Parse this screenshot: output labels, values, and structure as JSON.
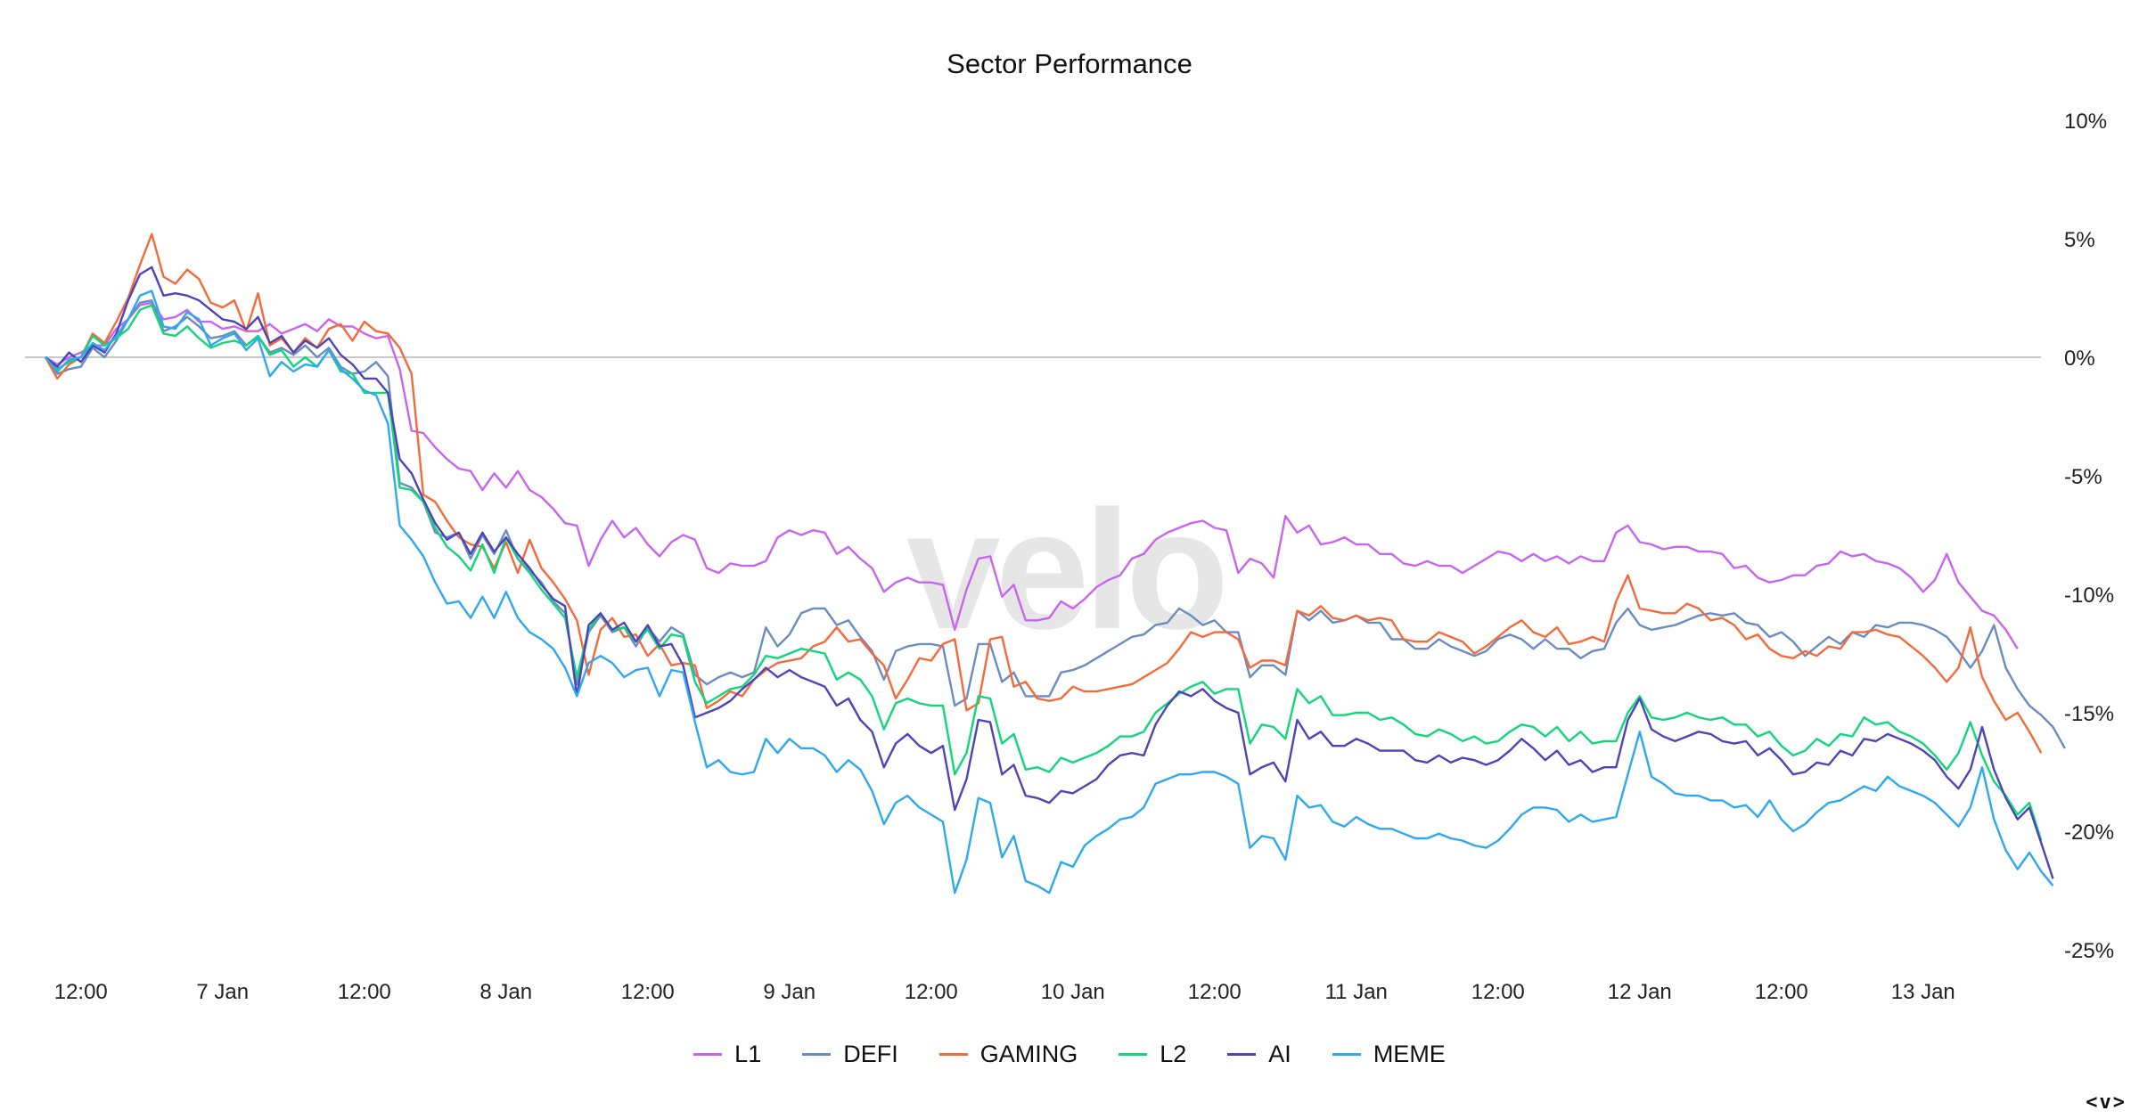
{
  "chart_data": {
    "type": "line",
    "title": "Sector Performance",
    "xlabel": "",
    "ylabel": "",
    "y_axis_position": "right",
    "ylim": [
      -25,
      10
    ],
    "yticks": [
      10,
      5,
      0,
      -5,
      -10,
      -15,
      -20,
      -25
    ],
    "ytick_labels": [
      "10%",
      "5%",
      "0%",
      "-5%",
      "-10%",
      "-15%",
      "-20%",
      "-25%"
    ],
    "x_start": "6 Jan 09:00",
    "x_step": "1 hour",
    "x_count": 168,
    "xticks": [
      {
        "hour": 3,
        "label": "12:00"
      },
      {
        "hour": 15,
        "label": "7 Jan"
      },
      {
        "hour": 27,
        "label": "12:00"
      },
      {
        "hour": 39,
        "label": "8 Jan"
      },
      {
        "hour": 51,
        "label": "12:00"
      },
      {
        "hour": 63,
        "label": "9 Jan"
      },
      {
        "hour": 75,
        "label": "12:00"
      },
      {
        "hour": 87,
        "label": "10 Jan"
      },
      {
        "hour": 99,
        "label": "12:00"
      },
      {
        "hour": 111,
        "label": "11 Jan"
      },
      {
        "hour": 123,
        "label": "12:00"
      },
      {
        "hour": 135,
        "label": "12 Jan"
      },
      {
        "hour": 147,
        "label": "12:00"
      },
      {
        "hour": 159,
        "label": "13 Jan"
      }
    ],
    "zero_line": true,
    "grid": false,
    "legend_position": "bottom",
    "watermark": "velo",
    "series": [
      {
        "name": "L1",
        "color": "#c865f0",
        "values": [
          0,
          -0.3,
          0,
          0.2,
          0.5,
          0.5,
          1.2,
          1.6,
          2.2,
          2.3,
          1.6,
          1.7,
          2,
          1.5,
          1.5,
          1.2,
          1.3,
          1.1,
          1.1,
          1.4,
          1,
          1.2,
          1.4,
          1.1,
          1.6,
          1.3,
          1.3,
          1.0,
          0.8,
          0.9,
          -0.5,
          -3.1,
          -3.2,
          -3.8,
          -4.3,
          -4.7,
          -4.8,
          -5.6,
          -4.9,
          -5.5,
          -4.8,
          -5.6,
          -5.9,
          -6.4,
          -7.0,
          -7.1,
          -8.8,
          -7.7,
          -6.9,
          -7.6,
          -7.2,
          -7.9,
          -8.4,
          -7.8,
          -7.5,
          -7.7,
          -8.9,
          -9.1,
          -8.7,
          -8.8,
          -8.8,
          -8.6,
          -7.6,
          -7.3,
          -7.5,
          -7.3,
          -7.4,
          -8.3,
          -8.0,
          -8.5,
          -8.9,
          -9.9,
          -9.5,
          -9.3,
          -9.5,
          -9.5,
          -9.6,
          -11.5,
          -9.8,
          -8.5,
          -8.4,
          -10.1,
          -9.6,
          -11.1,
          -11.1,
          -11.0,
          -10.3,
          -10.6,
          -10.2,
          -9.7,
          -9.4,
          -9.2,
          -8.5,
          -8.3,
          -7.7,
          -7.4,
          -7.2,
          -7.0,
          -6.9,
          -7.2,
          -7.3,
          -9.1,
          -8.5,
          -8.7,
          -9.3,
          -6.7,
          -7.4,
          -7.1,
          -7.9,
          -7.8,
          -7.6,
          -7.9,
          -7.9,
          -8.3,
          -8.3,
          -8.7,
          -8.8,
          -8.6,
          -8.8,
          -8.8,
          -9.1,
          -8.8,
          -8.5,
          -8.2,
          -8.3,
          -8.6,
          -8.3,
          -8.6,
          -8.4,
          -8.7,
          -8.4,
          -8.6,
          -8.6,
          -7.4,
          -7.1,
          -7.8,
          -7.9,
          -8.1,
          -8.0,
          -8.0,
          -8.2,
          -8.2,
          -8.3,
          -8.9,
          -8.8,
          -9.3,
          -9.5,
          -9.4,
          -9.2,
          -9.2,
          -8.8,
          -8.7,
          -8.2,
          -8.4,
          -8.3,
          -8.6,
          -8.7,
          -8.9,
          -9.3,
          -9.9,
          -9.4,
          -8.3,
          -9.5,
          -10.1,
          -10.7,
          -10.9,
          -11.5,
          -12.3
        ]
      },
      {
        "name": "DEFI",
        "color": "#6b8cc0",
        "values": [
          0,
          -0.7,
          -0.5,
          -0.4,
          0.4,
          0,
          0.7,
          1.6,
          2.3,
          2.4,
          1.1,
          1.3,
          1.7,
          1.3,
          0.8,
          0.9,
          1.1,
          0.5,
          0.9,
          0.2,
          0.4,
          0.1,
          0.5,
          0,
          0.4,
          -0.4,
          -0.7,
          -0.6,
          -0.2,
          -0.8,
          -5.3,
          -5.5,
          -6.1,
          -7.4,
          -7.6,
          -7.4,
          -8.5,
          -7.5,
          -8.3,
          -7.3,
          -8.5,
          -9.0,
          -9.5,
          -10.3,
          -10.8,
          -13.8,
          -11.6,
          -10.9,
          -11.6,
          -11.4,
          -12.2,
          -11.4,
          -12.0,
          -11.4,
          -11.7,
          -13.4,
          -13.8,
          -13.5,
          -13.3,
          -13.5,
          -13.3,
          -11.4,
          -12.2,
          -11.7,
          -10.8,
          -10.6,
          -10.6,
          -11.3,
          -11.1,
          -11.8,
          -12.4,
          -13.6,
          -12.4,
          -12.2,
          -12.1,
          -12.1,
          -12.2,
          -14.7,
          -14.4,
          -12.1,
          -12.1,
          -13.7,
          -13.3,
          -14.3,
          -14.3,
          -14.3,
          -13.3,
          -13.2,
          -13.0,
          -12.7,
          -12.4,
          -12.1,
          -11.8,
          -11.7,
          -11.3,
          -11.2,
          -10.6,
          -10.9,
          -11.3,
          -11.1,
          -11.6,
          -11.6,
          -13.5,
          -13.0,
          -13.0,
          -13.4,
          -10.7,
          -11.1,
          -10.7,
          -11.2,
          -11.1,
          -10.9,
          -11.2,
          -11.2,
          -11.9,
          -11.9,
          -12.3,
          -12.3,
          -11.9,
          -12.2,
          -12.4,
          -12.6,
          -12.4,
          -11.9,
          -11.7,
          -11.9,
          -12.3,
          -11.9,
          -12.3,
          -12.3,
          -12.7,
          -12.4,
          -12.3,
          -11.2,
          -10.6,
          -11.3,
          -11.5,
          -11.4,
          -11.3,
          -11.1,
          -10.9,
          -10.8,
          -10.9,
          -10.8,
          -11.2,
          -11.3,
          -11.8,
          -11.6,
          -12.0,
          -12.6,
          -12.2,
          -11.8,
          -12.1,
          -11.6,
          -11.8,
          -11.3,
          -11.4,
          -11.2,
          -11.2,
          -11.3,
          -11.5,
          -11.8,
          -12.4,
          -13.1,
          -12.4,
          -11.3,
          -13.1,
          -14.0,
          -14.7,
          -15.1,
          -15.6,
          -16.5
        ]
      },
      {
        "name": "GAMING",
        "color": "#f56a3a",
        "values": [
          0,
          -0.9,
          -0.3,
          0,
          1,
          0.6,
          1.5,
          2.5,
          3.9,
          5.2,
          3.4,
          3.1,
          3.7,
          3.3,
          2.3,
          2.1,
          2.4,
          1.1,
          2.7,
          0.5,
          0.8,
          0.2,
          0.8,
          0.4,
          1.2,
          1.4,
          0.7,
          1.5,
          1.1,
          1.0,
          0.4,
          -0.7,
          -5.8,
          -6.1,
          -6.9,
          -7.6,
          -7.9,
          -8.0,
          -8.9,
          -7.8,
          -9.1,
          -7.7,
          -8.9,
          -9.5,
          -10.2,
          -11.1,
          -13.4,
          -11.5,
          -11.0,
          -11.8,
          -11.7,
          -12.6,
          -12.1,
          -13.0,
          -12.9,
          -13.0,
          -14.8,
          -14.5,
          -14.1,
          -14.3,
          -13.6,
          -13.2,
          -12.9,
          -12.8,
          -12.7,
          -12.2,
          -12.0,
          -11.4,
          -12.0,
          -11.9,
          -12.5,
          -13.0,
          -14.4,
          -13.6,
          -12.7,
          -12.8,
          -12.1,
          -11.9,
          -14.9,
          -14.6,
          -11.9,
          -11.8,
          -13.9,
          -13.7,
          -14.4,
          -14.5,
          -14.4,
          -13.9,
          -14.1,
          -14.1,
          -14.0,
          -13.9,
          -13.8,
          -13.5,
          -13.2,
          -12.9,
          -12.3,
          -11.6,
          -11.8,
          -11.6,
          -11.6,
          -11.9,
          -13.1,
          -12.8,
          -12.8,
          -13.0,
          -10.7,
          -10.9,
          -10.5,
          -11.0,
          -11.1,
          -10.9,
          -11.1,
          -11.0,
          -11.1,
          -11.9,
          -12.0,
          -12.0,
          -11.6,
          -11.8,
          -12.0,
          -12.5,
          -12.2,
          -11.8,
          -11.4,
          -11.1,
          -11.6,
          -11.8,
          -11.4,
          -12.1,
          -12.0,
          -11.8,
          -12.0,
          -10.3,
          -9.2,
          -10.6,
          -10.7,
          -10.8,
          -10.8,
          -10.4,
          -10.6,
          -11.1,
          -11.0,
          -11.3,
          -11.9,
          -11.7,
          -12.3,
          -12.6,
          -12.7,
          -12.4,
          -12.6,
          -12.2,
          -12.3,
          -11.6,
          -11.6,
          -11.5,
          -11.7,
          -11.8,
          -12.2,
          -12.6,
          -13.1,
          -13.7,
          -13.1,
          -11.4,
          -13.5,
          -14.5,
          -15.3,
          -15.0,
          -15.8,
          -16.7
        ]
      },
      {
        "name": "L2",
        "color": "#12d67a",
        "values": [
          0,
          -0.5,
          -0.2,
          0,
          0.9,
          0.5,
          0.8,
          1.2,
          2.0,
          2.2,
          1.0,
          0.9,
          1.3,
          0.8,
          0.4,
          0.6,
          0.7,
          0.5,
          0.9,
          0.1,
          0.3,
          -0.4,
          0,
          -0.4,
          0.3,
          -0.6,
          -0.7,
          -1.5,
          -1.5,
          -1.5,
          -5.5,
          -5.6,
          -6.1,
          -7.2,
          -8.0,
          -8.4,
          -9.0,
          -7.9,
          -9.1,
          -7.6,
          -8.5,
          -9.1,
          -9.8,
          -10.4,
          -11.0,
          -13.5,
          -11.5,
          -10.8,
          -11.5,
          -11.4,
          -12.0,
          -11.5,
          -12.3,
          -11.7,
          -11.8,
          -13.7,
          -14.6,
          -14.3,
          -14.0,
          -13.9,
          -13.4,
          -12.6,
          -12.7,
          -12.5,
          -12.3,
          -12.4,
          -12.5,
          -13.6,
          -13.3,
          -13.6,
          -14.3,
          -15.7,
          -14.6,
          -14.4,
          -14.6,
          -14.7,
          -14.7,
          -17.6,
          -16.7,
          -14.3,
          -14.4,
          -16.3,
          -15.9,
          -17.4,
          -17.3,
          -17.5,
          -16.9,
          -17.1,
          -16.9,
          -16.7,
          -16.4,
          -16.0,
          -16.0,
          -15.8,
          -15.0,
          -14.6,
          -14.2,
          -13.9,
          -13.7,
          -14.2,
          -14.0,
          -14.0,
          -16.3,
          -15.5,
          -15.6,
          -16.1,
          -14.0,
          -14.6,
          -14.3,
          -15.1,
          -15.1,
          -15.0,
          -15.0,
          -15.3,
          -15.2,
          -15.5,
          -15.9,
          -16.0,
          -15.7,
          -15.9,
          -16.2,
          -16.0,
          -16.3,
          -16.2,
          -15.8,
          -15.5,
          -15.6,
          -16.0,
          -15.6,
          -16.2,
          -15.8,
          -16.3,
          -16.2,
          -16.2,
          -15.0,
          -14.3,
          -15.2,
          -15.3,
          -15.2,
          -15.0,
          -15.2,
          -15.3,
          -15.2,
          -15.5,
          -15.5,
          -16.0,
          -15.8,
          -16.4,
          -16.8,
          -16.6,
          -16.1,
          -16.4,
          -15.9,
          -16.0,
          -15.2,
          -15.5,
          -15.4,
          -15.8,
          -16.0,
          -16.3,
          -16.8,
          -17.4,
          -16.7,
          -15.4,
          -16.8,
          -17.9,
          -18.5,
          -19.3,
          -18.8,
          -20.4
        ]
      },
      {
        "name": "AI",
        "color": "#4c44b8",
        "values": [
          0,
          -0.4,
          0.2,
          -0.2,
          0.5,
          0.2,
          1.0,
          2.4,
          3.5,
          3.8,
          2.6,
          2.7,
          2.6,
          2.4,
          2.0,
          1.6,
          1.5,
          1.2,
          1.7,
          0.6,
          0.9,
          0.2,
          0.7,
          0.4,
          0.8,
          0.1,
          -0.3,
          -0.9,
          -0.9,
          -1.5,
          -4.3,
          -4.9,
          -6.0,
          -7.0,
          -7.7,
          -7.4,
          -8.3,
          -7.4,
          -8.2,
          -7.6,
          -8.3,
          -8.9,
          -9.6,
          -10.2,
          -10.5,
          -14.3,
          -11.3,
          -10.8,
          -11.5,
          -11.2,
          -12.0,
          -11.3,
          -12.2,
          -12.1,
          -13.0,
          -15.2,
          -15.0,
          -14.8,
          -14.5,
          -14.0,
          -13.6,
          -13.1,
          -13.5,
          -13.2,
          -13.5,
          -13.7,
          -13.9,
          -14.7,
          -14.4,
          -15.3,
          -15.8,
          -17.3,
          -16.3,
          -15.9,
          -16.4,
          -16.7,
          -16.4,
          -19.1,
          -17.8,
          -15.3,
          -15.4,
          -17.6,
          -17.2,
          -18.5,
          -18.6,
          -18.8,
          -18.3,
          -18.4,
          -18.1,
          -17.8,
          -17.2,
          -16.8,
          -16.7,
          -16.8,
          -15.5,
          -14.7,
          -14.1,
          -14.3,
          -14.0,
          -14.5,
          -14.8,
          -15.0,
          -17.6,
          -17.3,
          -17.1,
          -17.9,
          -15.3,
          -16.1,
          -15.8,
          -16.4,
          -16.4,
          -16.1,
          -16.3,
          -16.6,
          -16.6,
          -16.6,
          -17.0,
          -17.1,
          -16.8,
          -17.1,
          -16.9,
          -17.0,
          -17.2,
          -17.0,
          -16.6,
          -16.1,
          -16.5,
          -17.0,
          -16.6,
          -17.2,
          -17.0,
          -17.5,
          -17.3,
          -17.3,
          -15.3,
          -14.4,
          -15.7,
          -16.0,
          -16.2,
          -16.0,
          -15.8,
          -15.9,
          -16.2,
          -16.3,
          -16.2,
          -16.8,
          -16.5,
          -17.0,
          -17.6,
          -17.5,
          -17.1,
          -17.2,
          -16.6,
          -16.8,
          -16.1,
          -16.2,
          -15.9,
          -16.1,
          -16.3,
          -16.6,
          -17.0,
          -17.7,
          -18.2,
          -17.4,
          -15.6,
          -17.4,
          -18.6,
          -19.5,
          -19.0,
          -20.5,
          -22.0
        ]
      },
      {
        "name": "MEME",
        "color": "#2ea8f0",
        "values": [
          0,
          -0.6,
          -0.1,
          0,
          0.6,
          0.3,
          0.9,
          1.6,
          2.6,
          2.8,
          1.3,
          1.2,
          1.9,
          1.6,
          0.5,
          0.8,
          1.0,
          0.3,
          0.8,
          -0.8,
          -0.2,
          -0.6,
          -0.3,
          -0.4,
          0.3,
          -0.5,
          -0.9,
          -1.4,
          -1.6,
          -2.8,
          -7.1,
          -7.7,
          -8.4,
          -9.5,
          -10.4,
          -10.3,
          -11.0,
          -10.1,
          -11.0,
          -9.9,
          -11.0,
          -11.6,
          -11.9,
          -12.3,
          -13.1,
          -14.3,
          -12.9,
          -12.6,
          -12.9,
          -13.5,
          -13.2,
          -13.1,
          -14.3,
          -13.2,
          -13.3,
          -15.4,
          -17.3,
          -17.0,
          -17.5,
          -17.6,
          -17.5,
          -16.1,
          -16.7,
          -16.1,
          -16.5,
          -16.5,
          -16.8,
          -17.5,
          -17.0,
          -17.4,
          -18.3,
          -19.7,
          -18.8,
          -18.5,
          -19.0,
          -19.3,
          -19.6,
          -22.6,
          -21.2,
          -18.6,
          -18.8,
          -21.1,
          -20.2,
          -22.1,
          -22.3,
          -22.6,
          -21.3,
          -21.5,
          -20.6,
          -20.2,
          -19.9,
          -19.5,
          -19.4,
          -19.0,
          -18.0,
          -17.8,
          -17.6,
          -17.6,
          -17.5,
          -17.5,
          -17.7,
          -18.0,
          -20.7,
          -20.2,
          -20.3,
          -21.2,
          -18.5,
          -19.0,
          -18.9,
          -19.6,
          -19.8,
          -19.4,
          -19.7,
          -19.9,
          -19.9,
          -20.1,
          -20.3,
          -20.3,
          -20.1,
          -20.3,
          -20.4,
          -20.6,
          -20.7,
          -20.4,
          -19.9,
          -19.3,
          -19.0,
          -19.0,
          -19.1,
          -19.6,
          -19.3,
          -19.6,
          -19.5,
          -19.4,
          -17.6,
          -15.8,
          -17.7,
          -18.0,
          -18.4,
          -18.5,
          -18.5,
          -18.7,
          -18.7,
          -19.0,
          -18.9,
          -19.4,
          -18.7,
          -19.5,
          -20.0,
          -19.7,
          -19.2,
          -18.8,
          -18.7,
          -18.4,
          -18.1,
          -18.3,
          -17.7,
          -18.1,
          -18.3,
          -18.5,
          -18.8,
          -19.3,
          -19.8,
          -19.0,
          -17.3,
          -19.5,
          -20.8,
          -21.6,
          -20.9,
          -21.7,
          -22.3
        ]
      }
    ]
  },
  "ui": {
    "nav_arrows_label": "<v>"
  }
}
